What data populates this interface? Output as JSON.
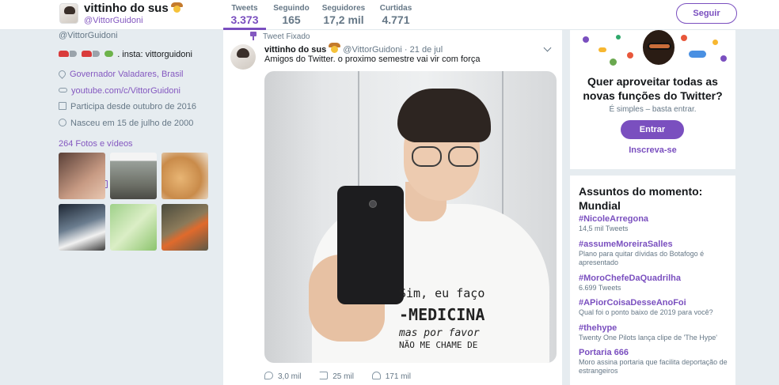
{
  "profile_nav": {
    "name": "vittinho do sus",
    "handle": "@VittorGuidoni",
    "stats": [
      {
        "label": "Tweets",
        "value": "3.373"
      },
      {
        "label": "Seguindo",
        "value": "165"
      },
      {
        "label": "Seguidores",
        "value": "17,2 mil"
      },
      {
        "label": "Curtidas",
        "value": "4.771"
      }
    ],
    "follow_label": "Seguir"
  },
  "profile": {
    "handle": "@VittorGuidoni",
    "bio_text": ". insta: vittorguidoni",
    "location": "Governador Valadares, Brasil",
    "website": "youtube.com/c/VittorGuidoni",
    "joined": "Participa desde outubro de 2016",
    "birthday": "Nasceu em 15 de julho de 2000",
    "media_label": "264 Fotos e vídeos"
  },
  "tweet": {
    "pinned_label": "Tweet Fixado",
    "author_name": "vittinho do sus",
    "author_handle": "@VittorGuidoni",
    "date": "21 de jul",
    "text": "Amigos do Twitter. o proximo semestre vai vir com força",
    "shirt_text": [
      "Sim, eu faço",
      "-MEDICINA",
      "mas por favor",
      "NÃO ME CHAME DE"
    ],
    "replies": "3,0 mil",
    "retweets": "25 mil",
    "likes": "171 mil"
  },
  "promo": {
    "title": "Quer aproveitar todas as novas funções do Twitter?",
    "subtitle": "É simples – basta entrar.",
    "enter_label": "Entrar",
    "signup_label": "Inscreva-se"
  },
  "trends": {
    "title": "Assuntos do momento: Mundial",
    "items": [
      {
        "name": "#NicoleArregona",
        "desc": "14,5 mil Tweets"
      },
      {
        "name": "#assumeMoreiraSalles",
        "desc": "Plano para quitar dívidas do Botafogo é apresentado"
      },
      {
        "name": "#MoroChefeDaQuadrilha",
        "desc": "6.699 Tweets"
      },
      {
        "name": "#APiorCoisaDesseAnoFoi",
        "desc": "Qual foi o ponto baixo de 2019 para você?"
      },
      {
        "name": "#thehype",
        "desc": "Twenty One Pilots lança clipe de 'The Hype'"
      },
      {
        "name": "Portaria 666",
        "desc": "Moro assina portaria que facilita deportação de estrangeiros"
      }
    ]
  },
  "colors": {
    "accent": "#7a4fbf",
    "link": "#8458c0",
    "background": "#e6ecf0"
  }
}
